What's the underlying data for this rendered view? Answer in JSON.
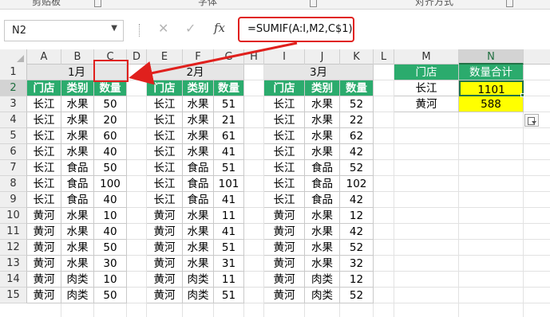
{
  "ribbon": {
    "groups": [
      "剪贴板",
      "字体",
      "对齐方式"
    ]
  },
  "formula_bar": {
    "name_box": "N2",
    "cancel_symbol": "✕",
    "enter_symbol": "✓",
    "fx_label": "fx",
    "formula": "=SUMIF(A:I,M2,C$1)"
  },
  "columns": [
    "A",
    "B",
    "C",
    "D",
    "E",
    "F",
    "G",
    "H",
    "I",
    "J",
    "K",
    "L",
    "M",
    "N"
  ],
  "rows": [
    "1",
    "2",
    "3",
    "4",
    "5",
    "6",
    "7",
    "8",
    "9",
    "10",
    "11",
    "12",
    "13",
    "14",
    "15"
  ],
  "tables": [
    {
      "month": "1月",
      "headers": [
        "门店",
        "类别",
        "数量"
      ],
      "rows": [
        [
          "长江",
          "水果",
          "50"
        ],
        [
          "长江",
          "水果",
          "20"
        ],
        [
          "长江",
          "水果",
          "60"
        ],
        [
          "长江",
          "水果",
          "40"
        ],
        [
          "长江",
          "食品",
          "50"
        ],
        [
          "长江",
          "食品",
          "100"
        ],
        [
          "长江",
          "食品",
          "40"
        ],
        [
          "黄河",
          "水果",
          "10"
        ],
        [
          "黄河",
          "水果",
          "40"
        ],
        [
          "黄河",
          "水果",
          "50"
        ],
        [
          "黄河",
          "水果",
          "30"
        ],
        [
          "黄河",
          "肉类",
          "10"
        ],
        [
          "黄河",
          "肉类",
          "50"
        ]
      ]
    },
    {
      "month": "2月",
      "headers": [
        "门店",
        "类别",
        "数量"
      ],
      "rows": [
        [
          "长江",
          "水果",
          "51"
        ],
        [
          "长江",
          "水果",
          "21"
        ],
        [
          "长江",
          "水果",
          "61"
        ],
        [
          "长江",
          "水果",
          "41"
        ],
        [
          "长江",
          "食品",
          "51"
        ],
        [
          "长江",
          "食品",
          "101"
        ],
        [
          "长江",
          "食品",
          "41"
        ],
        [
          "黄河",
          "水果",
          "11"
        ],
        [
          "黄河",
          "水果",
          "41"
        ],
        [
          "黄河",
          "水果",
          "51"
        ],
        [
          "黄河",
          "水果",
          "31"
        ],
        [
          "黄河",
          "肉类",
          "11"
        ],
        [
          "黄河",
          "肉类",
          "51"
        ]
      ]
    },
    {
      "month": "3月",
      "headers": [
        "门店",
        "类别",
        "数量"
      ],
      "rows": [
        [
          "长江",
          "水果",
          "52"
        ],
        [
          "长江",
          "水果",
          "22"
        ],
        [
          "长江",
          "水果",
          "62"
        ],
        [
          "长江",
          "水果",
          "42"
        ],
        [
          "长江",
          "食品",
          "52"
        ],
        [
          "长江",
          "食品",
          "102"
        ],
        [
          "长江",
          "食品",
          "42"
        ],
        [
          "黄河",
          "水果",
          "12"
        ],
        [
          "黄河",
          "水果",
          "42"
        ],
        [
          "黄河",
          "水果",
          "52"
        ],
        [
          "黄河",
          "水果",
          "32"
        ],
        [
          "黄河",
          "肉类",
          "12"
        ],
        [
          "黄河",
          "肉类",
          "52"
        ]
      ]
    }
  ],
  "summary": {
    "headers": [
      "门店",
      "数量合计"
    ],
    "rows": [
      [
        "长江",
        "1101"
      ],
      [
        "黄河",
        "588"
      ]
    ]
  },
  "colors": {
    "header_green": "#2bab6d",
    "month_gray": "#e6e6e6",
    "highlight_yellow": "#ffff00",
    "annotation_red": "#e0201d",
    "selection_green": "#217346"
  },
  "icons": [
    "chevron-down-icon",
    "cancel-icon",
    "enter-icon",
    "function-icon",
    "paste-options-icon",
    "annotation-arrow-icon"
  ]
}
